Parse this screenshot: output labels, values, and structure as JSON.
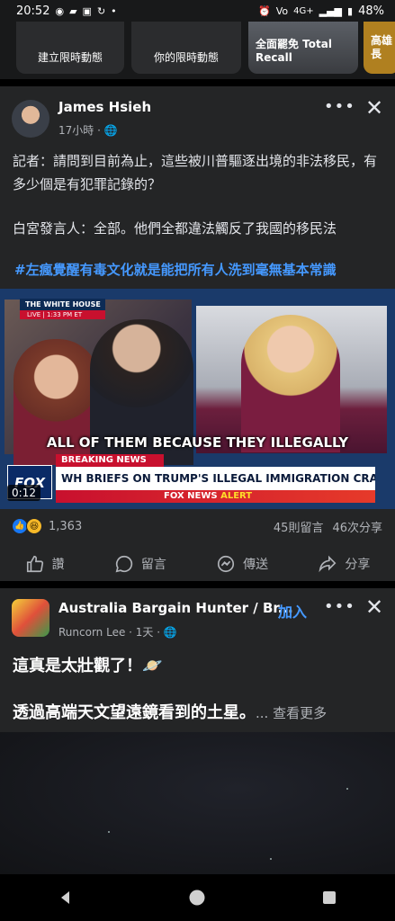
{
  "status_bar": {
    "time": "20:52",
    "network": "4G+",
    "battery": "48%",
    "icons": [
      "messenger-icon",
      "chat-icon",
      "calendar-icon",
      "sync-icon",
      "alarm-icon",
      "volte-icon",
      "signal-icon",
      "battery-icon"
    ]
  },
  "stories": [
    {
      "label": "建立限時動態"
    },
    {
      "label": "你的限時動態"
    },
    {
      "label": "全面罷免 Total Recall"
    },
    {
      "label": "高雄長"
    }
  ],
  "post1": {
    "author": "James Hsieh",
    "time": "17小時",
    "paragraph1": "記者：請問到目前為止，這些被川普驅逐出境的非法移民，有多少個是有犯罪記錄的？",
    "paragraph2": "白宮發言人：全部。他們全都違法觸反了我國的移民法",
    "hashtag": "#左瘋覺醒有毒文化就是能把所有人洗到毫無基本常識",
    "video": {
      "wh_tag": "THE WHITE HOUSE",
      "live_tag": "LIVE | 1:33 PM ET",
      "caption": "ALL OF THEM BECAUSE THEY ILLEGALLY",
      "breaking": "BREAKING NEWS",
      "headline": "WH BRIEFS ON TRUMP'S ILLEGAL IMMIGRATION CRACKDOWN",
      "alert_brand": "FOX NEWS",
      "alert_word": "ALERT",
      "logo": "FOX",
      "duration": "0:12"
    },
    "reaction_count": "1,363",
    "comments": "45則留言",
    "shares": "46次分享",
    "actions": {
      "like": "讚",
      "comment": "留言",
      "send": "傳送",
      "share": "分享"
    }
  },
  "post2": {
    "group": "Australia Bargain Hunter / Br...",
    "join": "加入",
    "author": "Runcorn Lee",
    "time": "1天",
    "line1": "這真是太壯觀了！🪐",
    "line2": "透過高端天文望遠鏡看到的土星。",
    "see_more": "... 查看更多"
  },
  "colors": {
    "background": "#18191a",
    "card": "#242526",
    "link": "#4599ff",
    "fox_red": "#c8102e"
  }
}
